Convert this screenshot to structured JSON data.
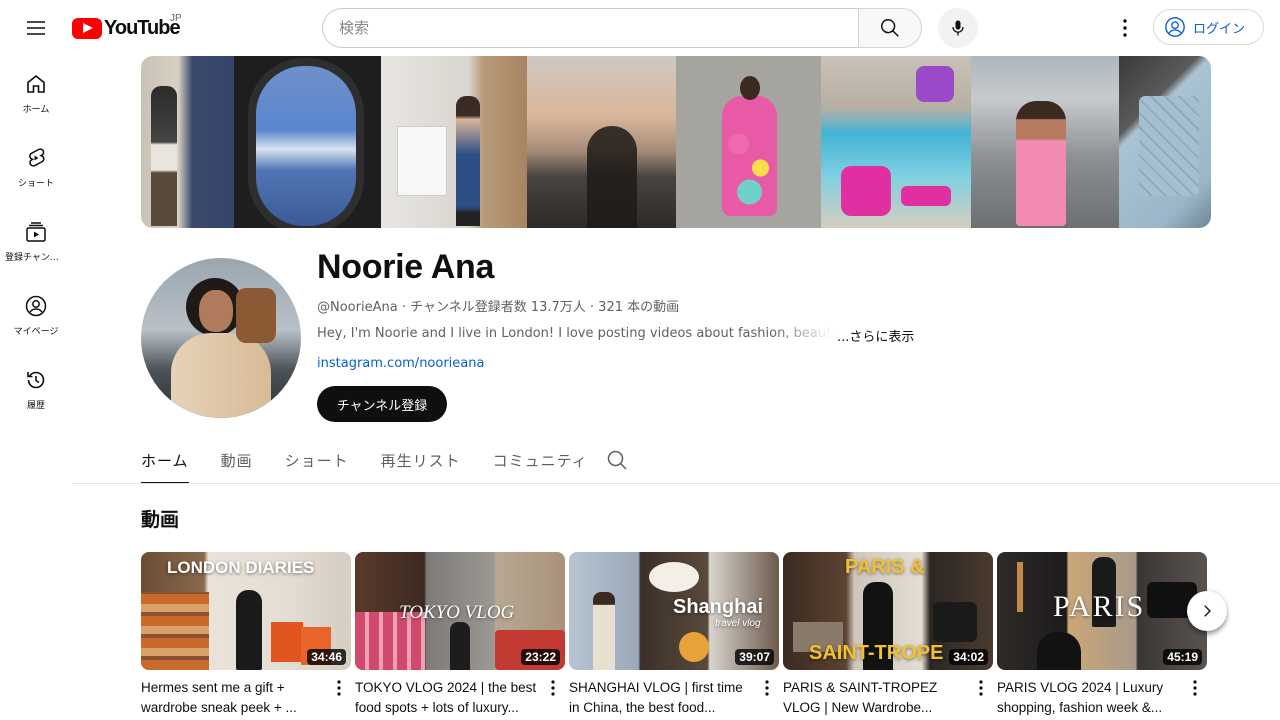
{
  "header": {
    "logo_text": "YouTube",
    "country_code": "JP",
    "search_placeholder": "検索",
    "login_label": "ログイン"
  },
  "guide": [
    {
      "label": "ホーム",
      "icon": "home-icon"
    },
    {
      "label": "ショート",
      "icon": "shorts-icon"
    },
    {
      "label": "登録チャンネル",
      "icon": "subscriptions-icon"
    },
    {
      "label": "マイページ",
      "icon": "you-icon"
    },
    {
      "label": "履歴",
      "icon": "history-icon"
    }
  ],
  "channel": {
    "name": "Noorie Ana",
    "meta": "@NoorieAna · チャンネル登録者数 13.7万人 · 321 本の動画",
    "description": "Hey, I'm Noorie and I live in London! I love posting videos about fashion, beauty and",
    "more_label": "...さらに表示",
    "link": "instagram.com/noorieana",
    "subscribe_label": "チャンネル登録"
  },
  "tabs": [
    {
      "label": "ホーム",
      "active": true
    },
    {
      "label": "動画",
      "active": false
    },
    {
      "label": "ショート",
      "active": false
    },
    {
      "label": "再生リスト",
      "active": false
    },
    {
      "label": "コミュニティ",
      "active": false
    }
  ],
  "shelf": {
    "title": "動画",
    "videos": [
      {
        "title": "Hermes sent me a gift + wardrobe sneak peek + ...",
        "duration": "34:46",
        "overlay": "LONDON DIARIES"
      },
      {
        "title": "TOKYO VLOG 2024 | the best food spots + lots of luxury...",
        "duration": "23:22",
        "overlay": "TOKYO VLOG"
      },
      {
        "title": "SHANGHAI VLOG | first time in China, the best food...",
        "duration": "39:07",
        "overlay": "Shanghai",
        "overlay_sub": "travel vlog"
      },
      {
        "title": "PARIS & SAINT-TROPEZ VLOG | New Wardrobe...",
        "duration": "34:02",
        "overlay": "PARIS &",
        "overlay_2": "SAINT-TROPE"
      },
      {
        "title": "PARIS VLOG 2024 | Luxury shopping, fashion week &...",
        "duration": "45:19",
        "overlay": "PARIS"
      }
    ]
  },
  "colors": {
    "brand_red": "#ff0000",
    "link_blue": "#065fd4",
    "text_primary": "#0f0f0f",
    "text_secondary": "#606060"
  }
}
